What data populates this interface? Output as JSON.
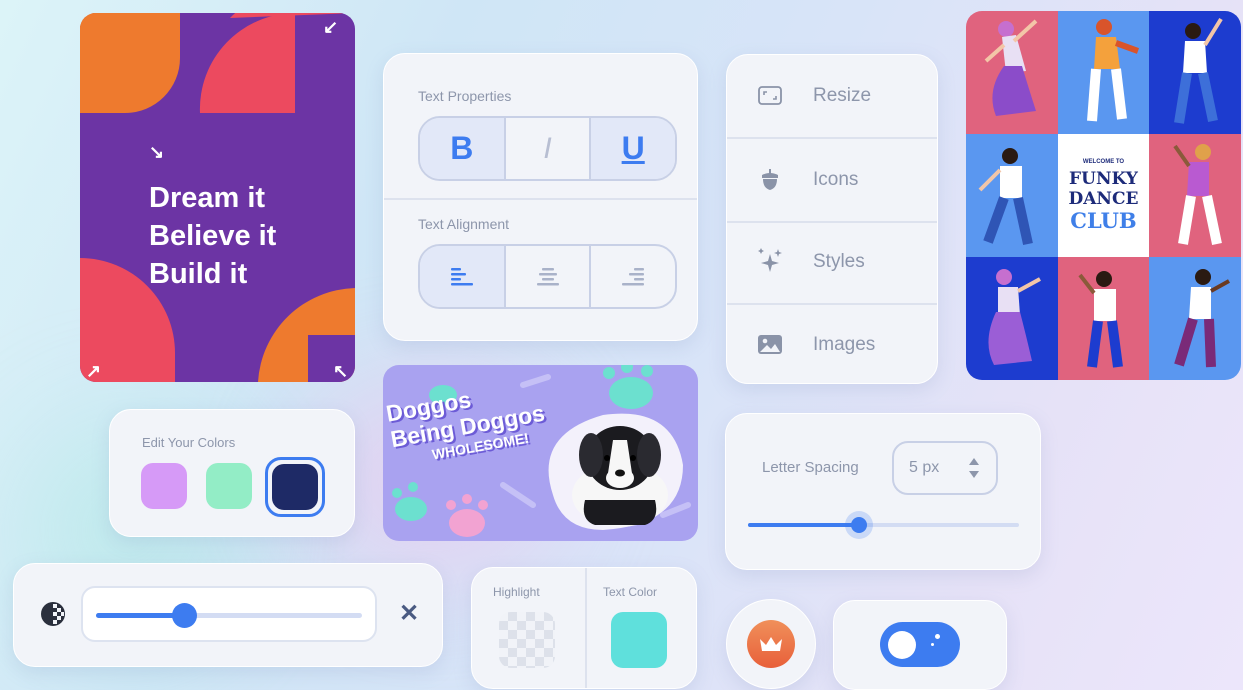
{
  "poster": {
    "line1": "Dream it",
    "line2": "Believe it",
    "line3": "Build it"
  },
  "text_properties": {
    "title": "Text Properties",
    "bold": "B",
    "italic": "I",
    "underline": "U",
    "alignment_title": "Text Alignment"
  },
  "menu": {
    "items": [
      {
        "label": "Resize",
        "icon": "resize-icon"
      },
      {
        "label": "Icons",
        "icon": "acorn-icon"
      },
      {
        "label": "Styles",
        "icon": "sparkles-icon"
      },
      {
        "label": "Images",
        "icon": "image-icon"
      }
    ]
  },
  "dance_poster": {
    "welcome": "WELCOME TO",
    "line1": "FUNKY",
    "line2": "DANCE",
    "line3": "CLUB"
  },
  "colors": {
    "title": "Edit Your Colors",
    "swatches": [
      "#d69af7",
      "#93edc6",
      "#1e2a66"
    ],
    "selected_index": 2
  },
  "doggos": {
    "line1": "Doggos",
    "line2": "Being Doggos",
    "line3": "WHOLESOME!"
  },
  "letter_spacing": {
    "label": "Letter Spacing",
    "value": "5 px",
    "slider_fraction": 0.41
  },
  "opacity_bar": {
    "slider_fraction": 0.33
  },
  "highlight_panel": {
    "highlight_label": "Highlight",
    "text_color_label": "Text Color",
    "text_color": "#5fe0dc"
  },
  "toggle": {
    "state": "on"
  },
  "accent": "#3d7cf0"
}
